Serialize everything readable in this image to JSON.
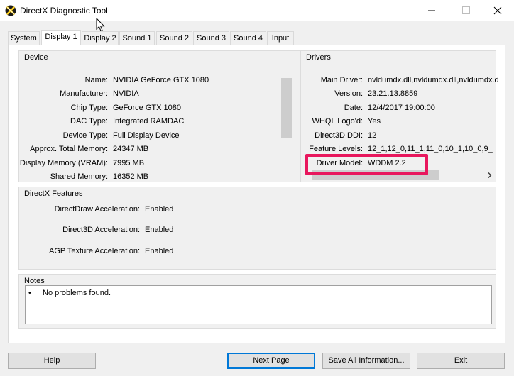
{
  "window": {
    "title": "DirectX Diagnostic Tool",
    "icon": "directx-x-icon",
    "controls": [
      "minimize-icon",
      "maximize-icon",
      "close-icon"
    ]
  },
  "tabs": [
    "System",
    "Display 1",
    "Display 2",
    "Sound 1",
    "Sound 2",
    "Sound 3",
    "Sound 4",
    "Input"
  ],
  "active_tab": "Display 1",
  "device": {
    "title": "Device",
    "rows": [
      {
        "label": "Name:",
        "value": "NVIDIA GeForce GTX 1080"
      },
      {
        "label": "Manufacturer:",
        "value": "NVIDIA"
      },
      {
        "label": "Chip Type:",
        "value": "GeForce GTX 1080"
      },
      {
        "label": "DAC Type:",
        "value": "Integrated RAMDAC"
      },
      {
        "label": "Device Type:",
        "value": "Full Display Device"
      },
      {
        "label": "Approx. Total Memory:",
        "value": "24347 MB"
      },
      {
        "label": "Display Memory (VRAM):",
        "value": "7995 MB"
      },
      {
        "label": "Shared Memory:",
        "value": "16352 MB"
      }
    ]
  },
  "drivers": {
    "title": "Drivers",
    "rows": [
      {
        "label": "Main Driver:",
        "value": "nvldumdx.dll,nvldumdx.dll,nvldumdx.d"
      },
      {
        "label": "Version:",
        "value": "23.21.13.8859"
      },
      {
        "label": "Date:",
        "value": "12/4/2017 19:00:00"
      },
      {
        "label": "WHQL Logo'd:",
        "value": "Yes"
      },
      {
        "label": "Direct3D DDI:",
        "value": "12"
      },
      {
        "label": "Feature Levels:",
        "value": "12_1,12_0,11_1,11_0,10_1,10_0,9_"
      },
      {
        "label": "Driver Model:",
        "value": "WDDM 2.2"
      }
    ],
    "scroll_right_icon": "chevron-right-icon"
  },
  "highlight_color": "#e8175d",
  "features": {
    "title": "DirectX Features",
    "rows": [
      {
        "label": "DirectDraw Acceleration:",
        "value": "Enabled"
      },
      {
        "label": "Direct3D Acceleration:",
        "value": "Enabled"
      },
      {
        "label": "AGP Texture Acceleration:",
        "value": "Enabled"
      }
    ]
  },
  "notes": {
    "title": "Notes",
    "bullet": "•",
    "text": "No problems found."
  },
  "buttons": {
    "help": "Help",
    "next_page": "Next Page",
    "save_all": "Save All Information...",
    "exit": "Exit"
  }
}
